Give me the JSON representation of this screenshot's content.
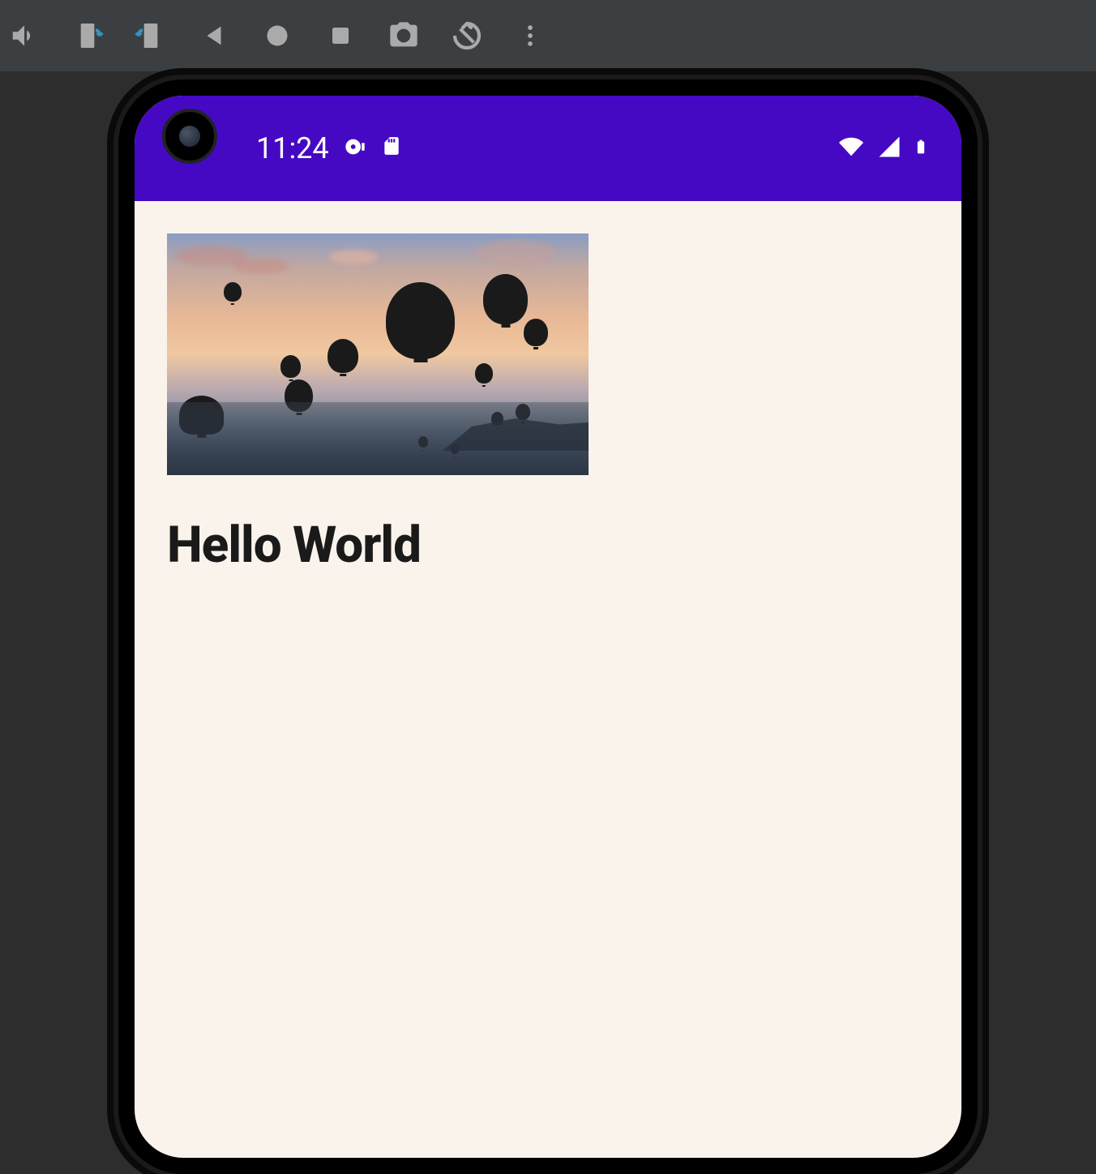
{
  "emulator": {
    "toolbar_icons": {
      "volume": "volume-icon",
      "rotate_left": "rotate-left-icon",
      "rotate_right": "rotate-right-icon",
      "back": "back-icon",
      "home": "home-circle-icon",
      "overview": "overview-square-icon",
      "screenshot": "camera-icon",
      "restart": "restart-icon",
      "more": "more-vert-icon"
    }
  },
  "status_bar": {
    "time": "11:24",
    "left_icons": {
      "disc": "disc-icon",
      "sd_card": "sd-card-icon"
    },
    "right_icons": {
      "wifi": "wifi-icon",
      "signal": "cellular-signal-icon",
      "battery": "battery-full-icon"
    },
    "background_color": "#4509c4"
  },
  "app": {
    "hero_image_alt": "hot-air-balloons-sunset",
    "heading": "Hello World",
    "background_color": "#faf3eb"
  }
}
